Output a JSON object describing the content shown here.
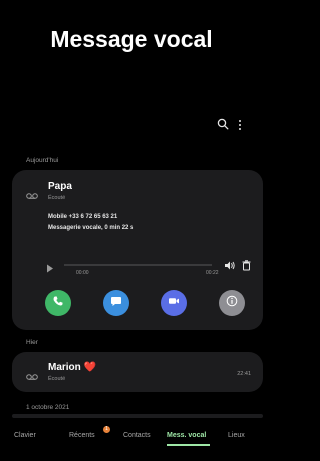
{
  "header": {
    "title": "Message vocal"
  },
  "sections": {
    "today": "Aujourd'hui",
    "yesterday": "Hier",
    "older": "1 octobre 2021"
  },
  "entries": [
    {
      "name": "Papa",
      "status": "Écouté",
      "detail_number": "Mobile +33 6 72 65 63 21",
      "detail_meta": "Messagerie vocale, 0 min 22 s",
      "time_start": "00:00",
      "time_end": "00:22",
      "progress": 0.0
    },
    {
      "name": "Marion ❤️",
      "status": "Écouté",
      "time": "22:41"
    }
  ],
  "actions": {
    "call_color": "#3fb767",
    "message_color": "#3b8fde",
    "video_color": "#5a6ee6",
    "info_color": "#8e8e93"
  },
  "tabs": [
    {
      "label": "Clavier",
      "active": false
    },
    {
      "label": "Récents",
      "active": false,
      "badge": "1"
    },
    {
      "label": "Contacts",
      "active": false
    },
    {
      "label": "Mess. vocal",
      "active": true
    },
    {
      "label": "Lieux",
      "active": false
    }
  ],
  "colors": {
    "background": "#000000",
    "card": "#1c1c1e",
    "accent": "#9ee6a6",
    "badge": "#e8833a"
  },
  "icons": [
    "search-icon",
    "more-options-icon",
    "voicemail-icon",
    "play-icon",
    "volume-icon",
    "delete-icon",
    "phone-icon",
    "message-icon",
    "video-icon",
    "info-icon"
  ]
}
